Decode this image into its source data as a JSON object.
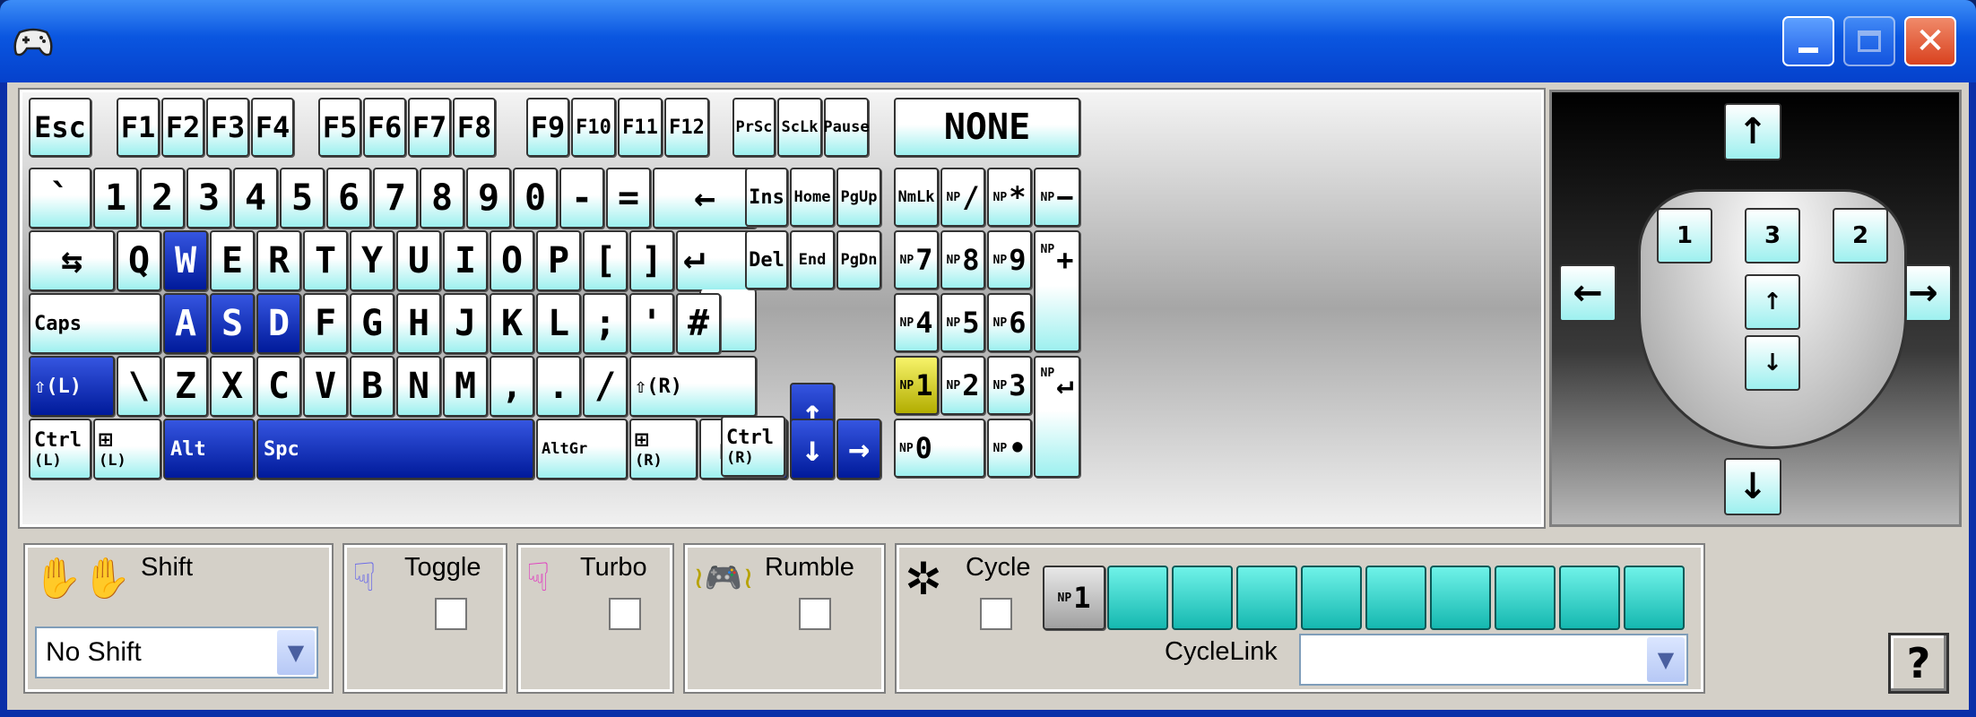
{
  "title": "",
  "keys": {
    "esc": "Esc",
    "f": [
      "F1",
      "F2",
      "F3",
      "F4",
      "F5",
      "F6",
      "F7",
      "F8",
      "F9",
      "F10",
      "F11",
      "F12"
    ],
    "prsc": "PrSc",
    "sclk": "ScLk",
    "pause": "Pause",
    "none": "NONE",
    "num_row": [
      "`",
      "1",
      "2",
      "3",
      "4",
      "5",
      "6",
      "7",
      "8",
      "9",
      "0",
      "-",
      "=",
      "←"
    ],
    "tab": "⇆",
    "top_row": [
      "Q",
      "W",
      "E",
      "R",
      "T",
      "Y",
      "U",
      "I",
      "O",
      "P",
      "[",
      "]"
    ],
    "enter": "↵",
    "caps": "Caps",
    "home_row": [
      "A",
      "S",
      "D",
      "F",
      "G",
      "H",
      "J",
      "K",
      "L",
      ";",
      "'",
      "#"
    ],
    "lshift": "⇧(L)",
    "bottom_row": [
      "\\",
      "Z",
      "X",
      "C",
      "V",
      "B",
      "N",
      "M",
      ",",
      ".",
      "/"
    ],
    "rshift": "⇧(R)",
    "lctrl": "Ctrl",
    "lctrl_sub": "(L)",
    "lwin_sub": "(L)",
    "alt": "Alt",
    "space": "Spc",
    "altgr": "AltGr",
    "rwin_sub": "(R)",
    "rctrl": "Ctrl",
    "rctrl_sub": "(R)",
    "ins": "Ins",
    "home": "Home",
    "pgup": "PgUp",
    "del": "Del",
    "end": "End",
    "pgdn": "PgDn",
    "up": "↑",
    "down": "↓",
    "left": "←",
    "right": "→",
    "numlk": "NmLk",
    "np_prefix": "NP",
    "np_div": "/",
    "np_mul": "*",
    "np_minus": "−",
    "np_plus": "+",
    "np7": "7",
    "np8": "8",
    "np9": "9",
    "np4": "4",
    "np5": "5",
    "np6": "6",
    "np1": "1",
    "np2": "2",
    "np3": "3",
    "np0": "0",
    "np_dot": "•",
    "np_enter": "↵"
  },
  "selected_keys": [
    "W",
    "A",
    "S",
    "D",
    "Alt",
    "Spc",
    "⇧(L)",
    "↑",
    "↓",
    "←",
    "→"
  ],
  "highlighted_key": "NP1",
  "mouse": {
    "up": "↑",
    "down": "↓",
    "left": "←",
    "right": "→",
    "button1": "1",
    "button2": "2",
    "button3": "3",
    "wheel_up": "↑",
    "wheel_down": "↓"
  },
  "options": {
    "shift_label": "Shift",
    "shift_value": "No Shift",
    "toggle_label": "Toggle",
    "turbo_label": "Turbo",
    "rumble_label": "Rumble",
    "cycle_label": "Cycle",
    "cycle_first_key_prefix": "NP",
    "cycle_first_key": "1",
    "cyclelink_label": "CycleLink",
    "cyclelink_value": "",
    "cycle_slots": 9
  },
  "help": "?",
  "colors": {
    "selected": "#001a9a",
    "highlight": "#e6e02a",
    "key_face": "#9df0ef",
    "cycle_slot": "#15b8b0"
  }
}
